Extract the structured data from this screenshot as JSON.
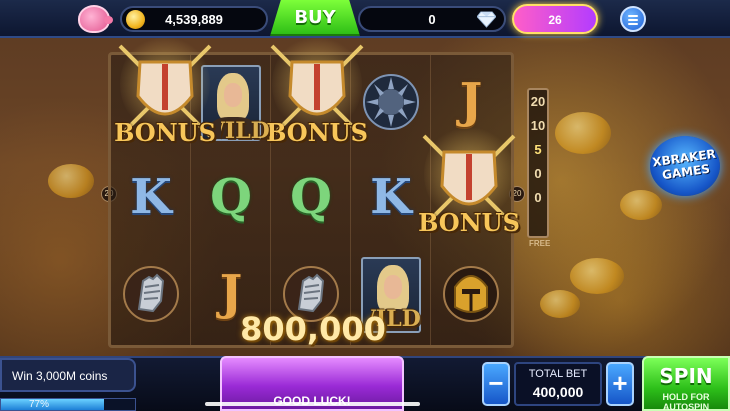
{
  "header": {
    "coins": "4,539,889",
    "buy_label": "BUY",
    "gems": "0",
    "level_badge": "26"
  },
  "reels": {
    "letters": {
      "k1": "K",
      "q1": "Q",
      "q2": "Q",
      "k2": "K",
      "j_top": "J",
      "j_bottom": "J"
    },
    "bonus_word": "BONUS",
    "wild_fragment": "WILD",
    "wild_fragment_bottom": "WILD",
    "side_marker": "20"
  },
  "free_spins_ladder": {
    "values": [
      "20",
      "10",
      "5",
      "0",
      "0"
    ],
    "label": "FREE"
  },
  "win_amount": "800,000",
  "brand": "XBRAKER GAMES",
  "bottom": {
    "quest_text": "Win 3,000M coins",
    "quest_progress_percent": "77%",
    "quest_progress_fraction": 0.77,
    "message": "GOOD LUCK!",
    "total_bet_label": "TOTAL BET",
    "total_bet_value": "400,000",
    "minus_label": "−",
    "plus_label": "+",
    "spin_label": "SPIN",
    "spin_sub": "HOLD FOR AUTOSPIN"
  },
  "colors": {
    "buy_green": "#2fbf16",
    "spin_green": "#2dbf1a",
    "bet_blue": "#1656c8",
    "message_purple": "#9a2ad6"
  }
}
